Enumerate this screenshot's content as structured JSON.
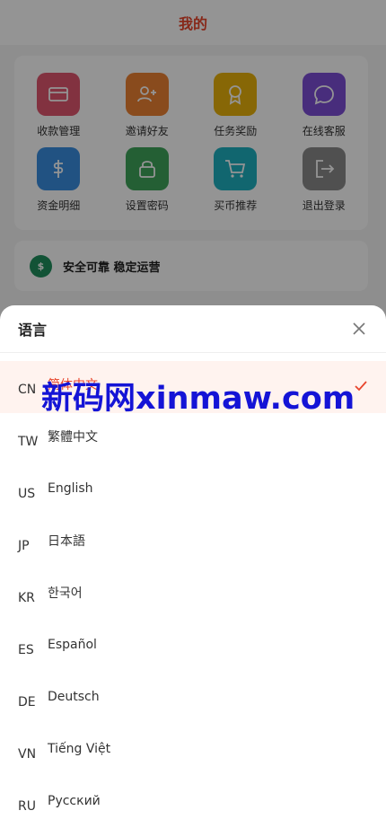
{
  "header": {
    "title": "我的"
  },
  "menu": [
    {
      "label": "收款管理",
      "icon": "card-icon",
      "color": "#e0566e"
    },
    {
      "label": "邀请好友",
      "icon": "add-user-icon",
      "color": "#ed8232"
    },
    {
      "label": "任务奖励",
      "icon": "award-icon",
      "color": "#e8b20c"
    },
    {
      "label": "在线客服",
      "icon": "chat-icon",
      "color": "#7d4fd6"
    },
    {
      "label": "资金明细",
      "icon": "dollar-icon",
      "color": "#3a8ee0"
    },
    {
      "label": "设置密码",
      "icon": "lock-icon",
      "color": "#3fa45a"
    },
    {
      "label": "买币推荐",
      "icon": "cart-icon",
      "color": "#1eb0c0"
    },
    {
      "label": "退出登录",
      "icon": "logout-icon",
      "color": "#8a8a8a"
    }
  ],
  "safe_banner": {
    "icon_text": "$",
    "text": "安全可靠 稳定运营"
  },
  "language_sheet": {
    "title": "语言",
    "options": [
      {
        "code": "CN",
        "name": "简体中文",
        "selected": true
      },
      {
        "code": "TW",
        "name": "繁體中文",
        "selected": false
      },
      {
        "code": "US",
        "name": "English",
        "selected": false
      },
      {
        "code": "JP",
        "name": "日本語",
        "selected": false
      },
      {
        "code": "KR",
        "name": "한국어",
        "selected": false
      },
      {
        "code": "ES",
        "name": "Español",
        "selected": false
      },
      {
        "code": "DE",
        "name": "Deutsch",
        "selected": false
      },
      {
        "code": "VN",
        "name": "Tiếng Việt",
        "selected": false
      },
      {
        "code": "RU",
        "name": "Русский",
        "selected": false
      }
    ]
  },
  "watermark": "新码网xinmaw.com",
  "colors": {
    "accent": "#e8452c",
    "selected_bg": "#fff3ef"
  }
}
